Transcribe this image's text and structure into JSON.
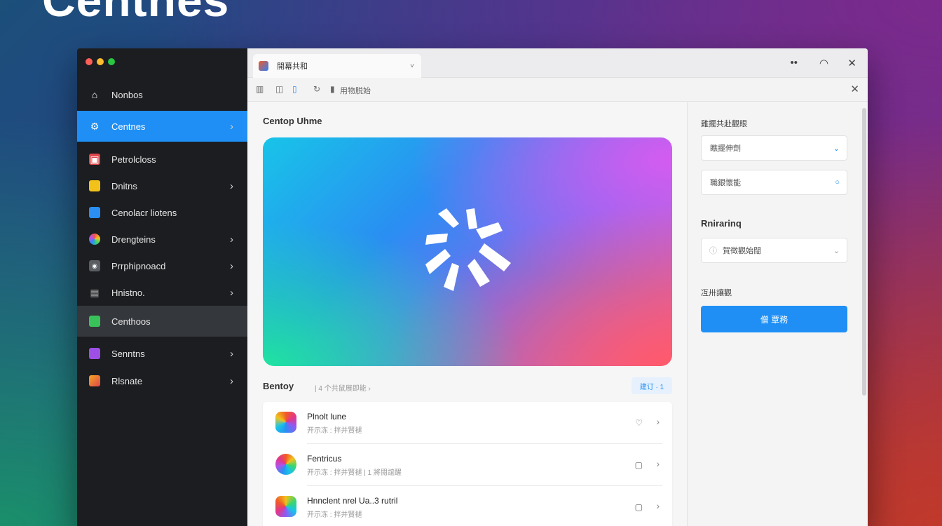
{
  "hero": {
    "title": "Centnes"
  },
  "sidebar": {
    "items": [
      {
        "label": "Nonbos",
        "icon": "home-icon",
        "chevron": false
      },
      {
        "label": "Centnes",
        "icon": "gear-icon",
        "chevron": true
      },
      {
        "label": "Petrolcloss",
        "icon": "mail-icon",
        "chevron": false
      },
      {
        "label": "Dnitns",
        "icon": "folder-icon",
        "chevron": true
      },
      {
        "label": "Cenolacr liotens",
        "icon": "image-icon",
        "chevron": false
      },
      {
        "label": "Drengteins",
        "icon": "palette-icon",
        "chevron": true
      },
      {
        "label": "Prrphipnoacd",
        "icon": "camera-icon",
        "chevron": true
      },
      {
        "label": "Hnistno.",
        "icon": "grid-icon",
        "chevron": true
      },
      {
        "label": "Centhoos",
        "icon": "sheet-icon",
        "chevron": false
      },
      {
        "label": "Senntns",
        "icon": "movie-icon",
        "chevron": true
      },
      {
        "label": "Rlsnate",
        "icon": "box-icon",
        "chevron": true
      }
    ]
  },
  "tabbar": {
    "tab_label": "開幕共和",
    "chevron": "˅"
  },
  "window_controls": {
    "more": "••",
    "wifi": "◠",
    "close": "✕"
  },
  "toolbar": {
    "address": "用物脱始",
    "close": "✕"
  },
  "content": {
    "section_title": "Centop Uhme",
    "recent_title": "Bentoy",
    "recent_sub": "| 4 个共鼠展即能 ›",
    "recent_button": "建订 · 1",
    "list": [
      {
        "name": "Plnolt lune",
        "meta": "开示冻 : 拌并賢褪",
        "action": "♡"
      },
      {
        "name": "Fentricus",
        "meta": "开示冻 : 拌并賢褪 | 1 將閱誼醒",
        "action": "▢"
      },
      {
        "name": "Hnnclent nrel Ua..3 rutril",
        "meta": "开示冻 : 拌并賢褪",
        "action": "▢"
      }
    ]
  },
  "right_panel": {
    "label1": "雞擺共赴觀眼",
    "field1": "瞧擺伸劑",
    "field2": "職銀懷能",
    "section2_title": "Rnirarinq",
    "field3": "賀徵觀始闊",
    "label3": "冱卅讓觀",
    "button": "僧 覃務"
  },
  "colors": {
    "accent": "#1f8ff5",
    "sidebar_bg": "#1b1d20",
    "traffic_red": "#ff5f57",
    "traffic_yellow": "#febc2e",
    "traffic_green": "#28c840"
  }
}
